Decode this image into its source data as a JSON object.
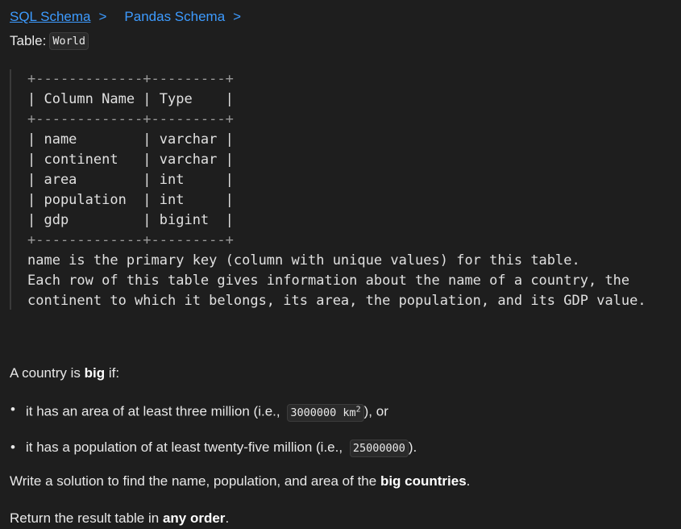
{
  "tabs": [
    {
      "label": "SQL Schema",
      "chevron": ">"
    },
    {
      "label": "Pandas Schema",
      "chevron": ">"
    }
  ],
  "table_line": {
    "prefix": "Table:",
    "table_name": "World"
  },
  "schema": {
    "lines": [
      "+-------------+---------+",
      "| Column Name | Type    |",
      "+-------------+---------+",
      "| name        | varchar |",
      "| continent   | varchar |",
      "| area        | int     |",
      "| population  | int     |",
      "| gdp         | bigint  |",
      "+-------------+---------+",
      "name is the primary key (column with unique values) for this table.",
      "Each row of this table gives information about the name of a country, the",
      "continent to which it belongs, its area, the population, and its GDP value."
    ]
  },
  "description": {
    "intro_prefix": "A country is ",
    "intro_bold": "big",
    "intro_suffix": " if:",
    "criteria": [
      {
        "prefix": "it has an area of at least three million (i.e., ",
        "code": "3000000 km",
        "sup": "2",
        "suffix": "), or"
      },
      {
        "prefix": "it has a population of at least twenty-five million (i.e., ",
        "code": "25000000",
        "sup": "",
        "suffix": ")."
      }
    ],
    "task_prefix": "Write a solution to find the name, population, and area of the ",
    "task_bold": "big countries",
    "task_suffix": ".",
    "return_prefix": "Return the result table in ",
    "return_bold": "any order",
    "return_suffix": "."
  }
}
